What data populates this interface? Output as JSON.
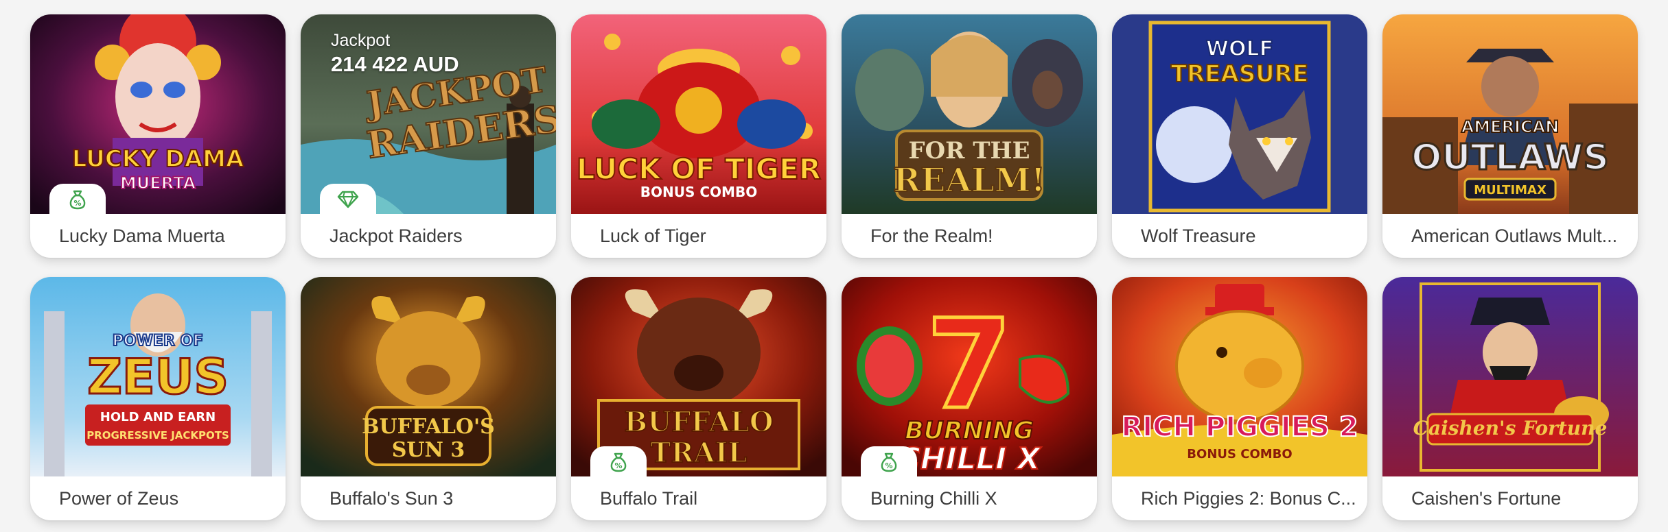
{
  "row1": [
    {
      "name": "Lucky Dama Muerta",
      "art": "LUCKY DAMA",
      "art2": "MUERTA",
      "badge": "money-bag-icon"
    },
    {
      "name": "Jackpot Raiders",
      "art": "JACKPOT",
      "art2": "RAIDERS",
      "badge": "diamond-icon"
    },
    {
      "name": "Luck of Tiger",
      "art": "LUCK OF TIGER",
      "art2": "BONUS COMBO"
    },
    {
      "name": "For the Realm!",
      "art": "FOR THE",
      "art2": "REALM!"
    },
    {
      "name": "Wolf Treasure",
      "art": "WOLF",
      "art2": "TREASURE"
    },
    {
      "name": "American Outlaws Mult...",
      "art": "AMERICAN",
      "art2": "OUTLAWS",
      "art3": "MULTIMAX"
    }
  ],
  "row2": [
    {
      "name": "Power of Zeus",
      "art": "POWER OF",
      "art2": "ZEUS",
      "art3": "HOLD AND EARN",
      "art4": "PROGRESSIVE JACKPOTS"
    },
    {
      "name": "Buffalo's Sun 3",
      "art": "BUFFALO'S",
      "art2": "SUN 3"
    },
    {
      "name": "Buffalo Trail",
      "art": "BUFFALO",
      "art2": "TRAIL",
      "badge": "money-bag-icon"
    },
    {
      "name": "Burning Chilli X",
      "art": "BURNING",
      "art2": "CHILLI X",
      "badge": "money-bag-icon"
    },
    {
      "name": "Rich Piggies 2: Bonus C...",
      "art": "RICH PIGGIES 2",
      "art2": "BONUS COMBO"
    },
    {
      "name": "Caishen's Fortune",
      "art": "Caishen's Fortune"
    }
  ],
  "jackpot": {
    "label": "Jackpot",
    "amount": "214 422 AUD"
  },
  "colors": {
    "badge_green": "#3fa34d",
    "title_text": "#3d3d3d",
    "card_bg": "#ffffff",
    "page_bg": "#f4f4f4"
  }
}
